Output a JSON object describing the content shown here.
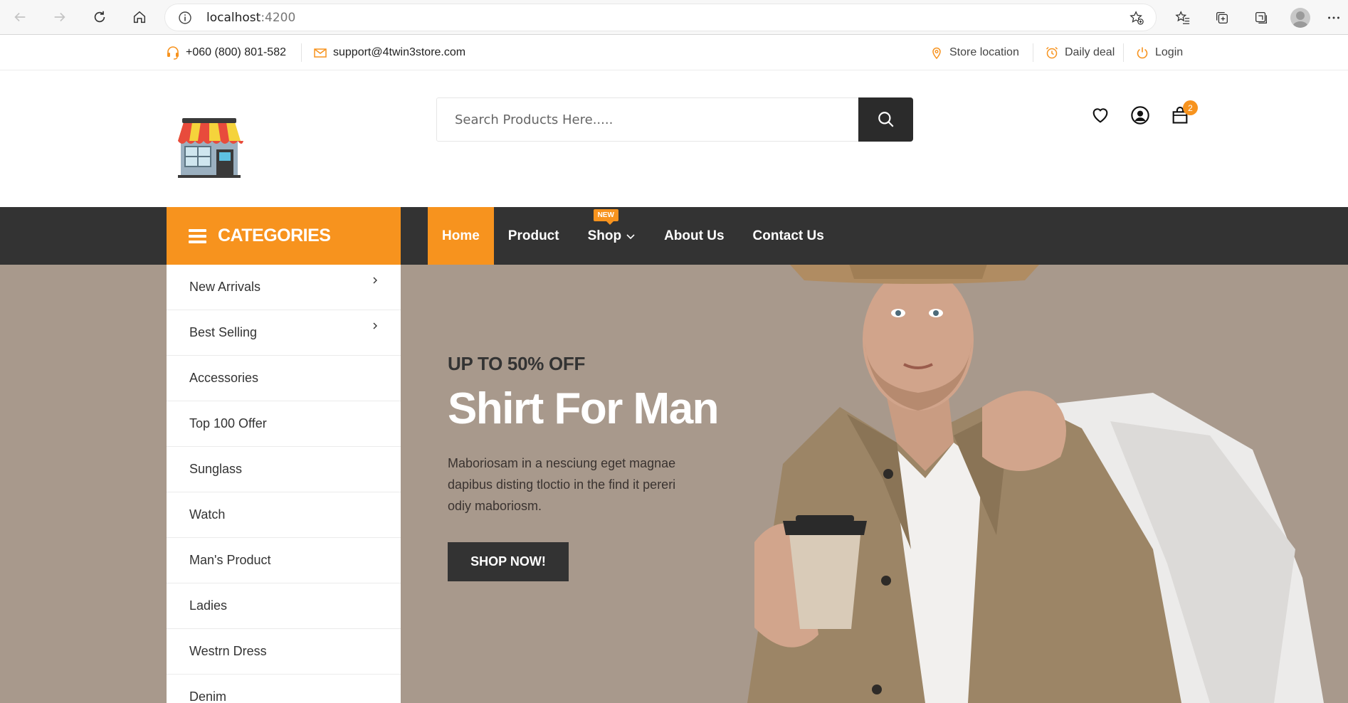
{
  "browser": {
    "url_host": "localhost",
    "url_port": ":4200"
  },
  "topbar": {
    "phone": "+060 (800) 801-582",
    "email": "support@4twin3store.com",
    "store_location": "Store location",
    "daily_deal": "Daily deal",
    "login": "Login"
  },
  "header": {
    "search_placeholder": "Search Products Here.....",
    "cart_count": "2"
  },
  "nav": {
    "categories_label": "CATEGORIES",
    "new_badge": "NEW",
    "items": [
      {
        "label": "Home"
      },
      {
        "label": "Product"
      },
      {
        "label": "Shop"
      },
      {
        "label": "About Us"
      },
      {
        "label": "Contact Us"
      }
    ]
  },
  "categories": [
    {
      "label": "New Arrivals"
    },
    {
      "label": "Best Selling"
    },
    {
      "label": "Accessories"
    },
    {
      "label": "Top 100 Offer"
    },
    {
      "label": "Sunglass"
    },
    {
      "label": "Watch"
    },
    {
      "label": "Man's Product"
    },
    {
      "label": "Ladies"
    },
    {
      "label": "Westrn Dress"
    },
    {
      "label": "Denim"
    }
  ],
  "hero": {
    "promo": "UP TO 50% OFF",
    "title": "Shirt For Man",
    "description": "Maboriosam in a nesciung eget magnae dapibus disting tloctio in the find it pereri odiy maboriosm.",
    "cta": "SHOP NOW!"
  },
  "colors": {
    "accent": "#f7931e",
    "dark": "#333333",
    "hero_bg": "#a8998c"
  }
}
